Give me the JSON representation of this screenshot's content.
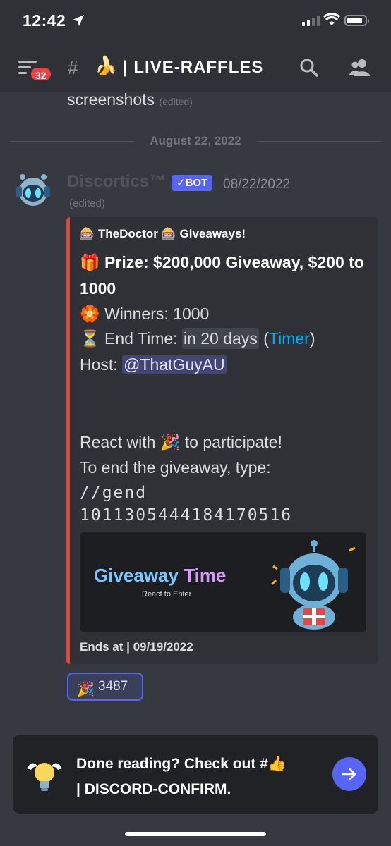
{
  "status": {
    "time": "12:42"
  },
  "header": {
    "badge_count": "32",
    "hash": "#",
    "channel_emoji": "🍌",
    "channel_name": "| LIVE-RAFFLES"
  },
  "chat": {
    "previous_text": "screenshots",
    "previous_edited": "(edited)",
    "date_divider": "August 22, 2022",
    "message": {
      "author": "Discortics™",
      "bot_tag": "✓BOT",
      "timestamp": "08/22/2022",
      "edited": "(edited)",
      "embed": {
        "author_line": "🎰 TheDoctor 🎰 Giveaways!",
        "title_emoji": "🎁",
        "title": "Prize: $200,000 Giveaway, $200 to 1000",
        "winners_emoji": "🏵️",
        "winners": "Winners: 1000",
        "endtime_emoji": "⏳",
        "endtime_label": "End Time:",
        "endtime_value": "in 20 days",
        "timer_open": "(",
        "timer_link": "Timer",
        "timer_close": ")",
        "host_label": "Host:",
        "host_mention": "@ThatGuyAU",
        "react_prefix": "React with",
        "react_emoji": "🎉",
        "react_suffix": "to participate!",
        "end_instruction": "To end the giveaway, type:",
        "command": "//gend",
        "message_id": "1011305444184170516",
        "image_title_a": "Giveaway",
        "image_title_b": "Time",
        "image_subtitle": "React to Enter",
        "footer": "Ends at | 09/19/2022"
      },
      "reaction": {
        "emoji": "🎉",
        "count": "3487"
      }
    }
  },
  "banner": {
    "icon": "lightbulb-icon",
    "line1": "Done reading? Check out #👍",
    "line2": "| DISCORD-CONFIRM."
  },
  "colors": {
    "accent": "#5865f2",
    "embed_border": "#d84a3f",
    "link": "#00aff4",
    "badge": "#ed4245"
  }
}
